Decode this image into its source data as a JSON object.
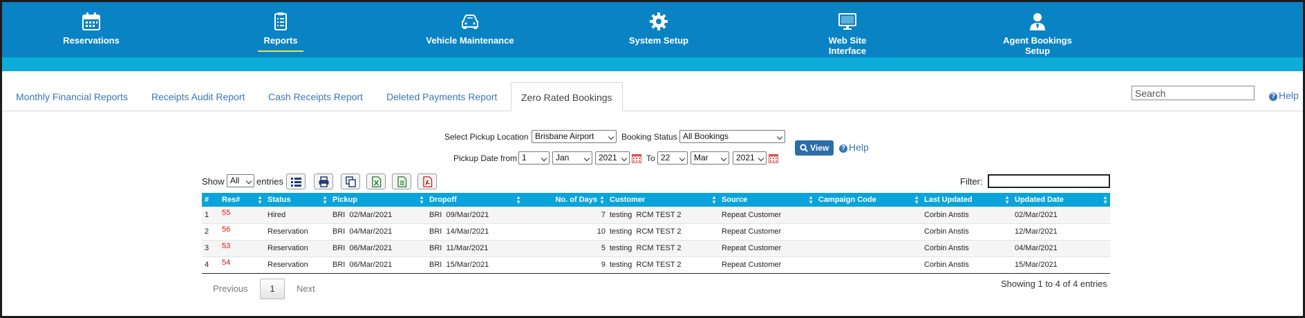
{
  "nav": {
    "items": [
      {
        "label": "Reservations",
        "icon": "calendar-icon"
      },
      {
        "label": "Reports",
        "icon": "clipboard-list-icon"
      },
      {
        "label": "Vehicle Maintenance",
        "icon": "car-icon"
      },
      {
        "label": "System Setup",
        "icon": "gear-icon"
      },
      {
        "label": "Web Site Interface",
        "icon": "monitor-icon"
      },
      {
        "label": "Agent Bookings Setup",
        "icon": "agent-icon"
      }
    ],
    "active": "Reports",
    "colors": {
      "bar": "#0a83c4",
      "subbar": "#0dacd9",
      "active_underline": "#f2e24a"
    }
  },
  "tabs": {
    "items": [
      "Monthly Financial Reports",
      "Receipts Audit Report",
      "Cash Receipts Report",
      "Deleted Payments Report",
      "Zero Rated Bookings"
    ],
    "active": "Zero Rated Bookings"
  },
  "search": {
    "placeholder": "Search",
    "value": ""
  },
  "help": {
    "label": "Help"
  },
  "form": {
    "pickup_location_label": "Select Pickup Location",
    "pickup_location_value": "Brisbane Airport",
    "booking_status_label": "Booking Status",
    "booking_status_value": "All Bookings",
    "date_from_label": "Pickup Date from",
    "from_day": "1",
    "from_month": "Jan",
    "from_year": "2021",
    "to_label": "To",
    "to_day": "22",
    "to_month": "Mar",
    "to_year": "2021",
    "view_button": "View",
    "help_label": "Help"
  },
  "table_controls": {
    "show_label": "Show",
    "show_value": "All",
    "entries_label": "entries",
    "filter_label": "Filter:",
    "filter_value": "",
    "tools": [
      "column-list-icon",
      "print-icon",
      "copy-icon",
      "excel-icon",
      "csv-icon",
      "pdf-icon"
    ]
  },
  "table": {
    "columns": [
      "#",
      "Res#",
      "Status",
      "Pickup",
      "Dropoff",
      "No. of Days",
      "Customer",
      "Source",
      "Campaign Code",
      "Last Updated",
      "Updated Date"
    ],
    "rows": [
      {
        "n": "1",
        "res": "55",
        "status": "Hired",
        "pickup": "BRI  02/Mar/2021",
        "dropoff": "BRI  09/Mar/2021",
        "days": "7",
        "customer": "testing  RCM TEST 2",
        "source": "Repeat Customer",
        "campaign": "",
        "last_updated": "Corbin Anstis",
        "updated_date": "02/Mar/2021"
      },
      {
        "n": "2",
        "res": "56",
        "status": "Reservation",
        "pickup": "BRI  04/Mar/2021",
        "dropoff": "BRI  14/Mar/2021",
        "days": "10",
        "customer": "testing  RCM TEST 2",
        "source": "Repeat Customer",
        "campaign": "",
        "last_updated": "Corbin Anstis",
        "updated_date": "12/Mar/2021"
      },
      {
        "n": "3",
        "res": "53",
        "status": "Reservation",
        "pickup": "BRI  06/Mar/2021",
        "dropoff": "BRI  11/Mar/2021",
        "days": "5",
        "customer": "testing  RCM TEST 2",
        "source": "Repeat Customer",
        "campaign": "",
        "last_updated": "Corbin Anstis",
        "updated_date": "04/Mar/2021"
      },
      {
        "n": "4",
        "res": "54",
        "status": "Reservation",
        "pickup": "BRI  06/Mar/2021",
        "dropoff": "BRI  15/Mar/2021",
        "days": "9",
        "customer": "testing  RCM TEST 2",
        "source": "Repeat Customer",
        "campaign": "",
        "last_updated": "Corbin Anstis",
        "updated_date": "15/Mar/2021"
      }
    ],
    "header_color": "#0aa4da",
    "res_color": "#e01010"
  },
  "pagination": {
    "previous": "Previous",
    "current": "1",
    "next": "Next",
    "info": "Showing 1 to 4 of 4 entries"
  }
}
